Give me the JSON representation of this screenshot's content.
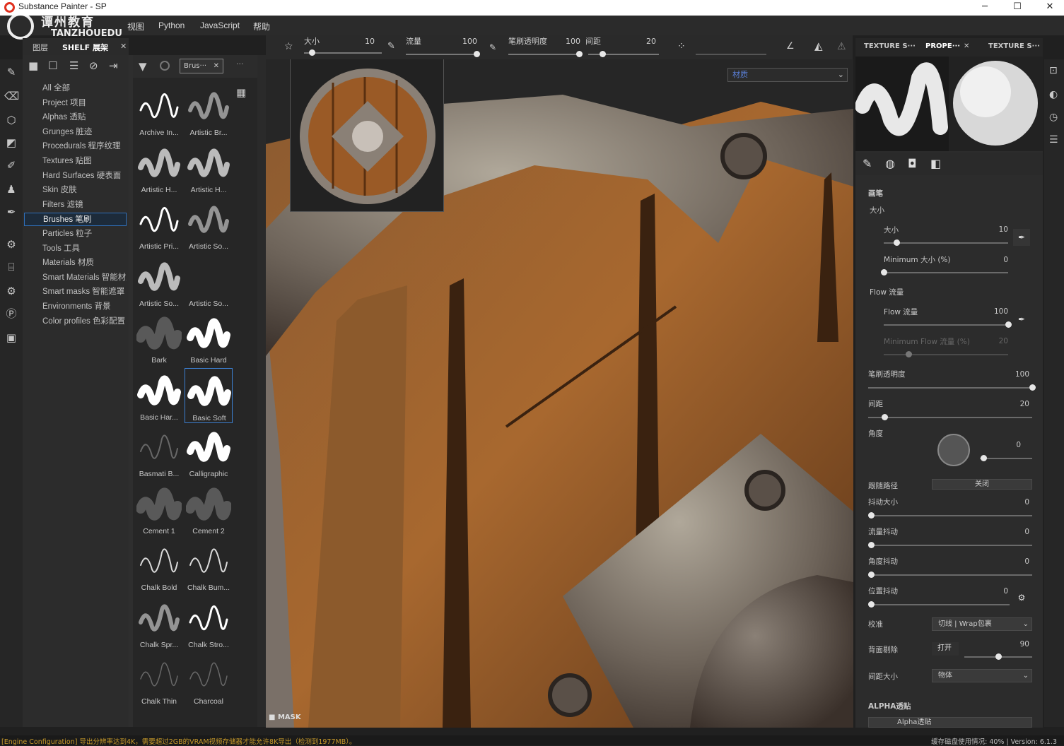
{
  "window": {
    "title": "Substance Painter - SP",
    "min": "─",
    "max": "☐",
    "close": "✕"
  },
  "watermark": {
    "line1": "TANZHOUEDU",
    "line2": "TANZHOUEDU",
    "cn": "谭州教育"
  },
  "menu": [
    "视图",
    "Python",
    "JavaScript",
    "帮助"
  ],
  "shelf_tabs": {
    "layers": "图层",
    "shelf": "SHELF 展架",
    "close": "✕"
  },
  "categories": [
    {
      "label": "All 全部"
    },
    {
      "label": "Project 项目"
    },
    {
      "label": "Alphas 透贴"
    },
    {
      "label": "Grunges 脏迹"
    },
    {
      "label": "Procedurals 程序纹理"
    },
    {
      "label": "Textures 贴图"
    },
    {
      "label": "Hard Surfaces 硬表面"
    },
    {
      "label": "Skin 皮肤"
    },
    {
      "label": "Filters 滤镜"
    },
    {
      "label": "Brushes 笔刷"
    },
    {
      "label": "Particles 粒子"
    },
    {
      "label": "Tools 工具"
    },
    {
      "label": "Materials 材质"
    },
    {
      "label": "Smart Materials 智能材质"
    },
    {
      "label": "Smart masks 智能遮罩"
    },
    {
      "label": "Environments 背景"
    },
    {
      "label": "Color profiles 色彩配置"
    }
  ],
  "brush_filter": {
    "chip": "Brus···",
    "chip_close": "✕",
    "more": "···"
  },
  "brushes": [
    {
      "label": "Archive In...",
      "style": "hard"
    },
    {
      "label": "Artistic Br...",
      "style": "soft"
    },
    {
      "label": "Artistic H...",
      "style": "rough"
    },
    {
      "label": "Artistic H...",
      "style": "rough"
    },
    {
      "label": "Artistic Pri...",
      "style": "hard"
    },
    {
      "label": "Artistic So...",
      "style": "soft"
    },
    {
      "label": "Artistic So...",
      "style": "rough"
    },
    {
      "label": "Artistic So...",
      "style": "none"
    },
    {
      "label": "Bark",
      "style": "blur"
    },
    {
      "label": "Basic Hard",
      "style": "bold"
    },
    {
      "label": "Basic Har...",
      "style": "bold"
    },
    {
      "label": "Basic Soft",
      "style": "bold"
    },
    {
      "label": "Basmati B...",
      "style": "dots"
    },
    {
      "label": "Calligraphic",
      "style": "bold"
    },
    {
      "label": "Cement 1",
      "style": "blur"
    },
    {
      "label": "Cement 2",
      "style": "blur"
    },
    {
      "label": "Chalk Bold",
      "style": "thin"
    },
    {
      "label": "Chalk Bum...",
      "style": "thin"
    },
    {
      "label": "Chalk Spr...",
      "style": "soft"
    },
    {
      "label": "Chalk Stro...",
      "style": "hard"
    },
    {
      "label": "Chalk Thin",
      "style": "faint"
    },
    {
      "label": "Charcoal",
      "style": "faint"
    }
  ],
  "selected_brush": "Basic Soft",
  "selected_category": "Brushes 笔刷",
  "toolbar": {
    "size_label": "大小",
    "size_value": "10",
    "flow_label": "流量",
    "flow_value": "100",
    "opacity_label": "笔刷透明度",
    "opacity_value": "100",
    "spacing_label": "间距",
    "spacing_value": "20",
    "levels": {
      "size": 0.1,
      "flow": 1.0,
      "opacity": 1.0,
      "spacing": 0.2
    }
  },
  "viewport": {
    "material_select": "材质",
    "mask_label": "MASK"
  },
  "right_tabs": {
    "tab1": "TEXTURE S···",
    "tab2": "PROPE···",
    "tab2_close": "✕",
    "tab3": "TEXTURE S···"
  },
  "props": {
    "section_brush": "画笔",
    "size_group": "大小",
    "size_label": "大小",
    "size_value": "10",
    "min_size_label": "Minimum 大小 (%)",
    "min_size_value": "0",
    "flow_group": "Flow 流量",
    "flow_label": "Flow 流量",
    "flow_value": "100",
    "min_flow_label": "Minimum Flow 流量 (%)",
    "min_flow_value": "20",
    "opacity_label": "笔刷透明度",
    "opacity_value": "100",
    "spacing_label": "间距",
    "spacing_value": "20",
    "angle_label": "角度",
    "angle_value": "0",
    "follow_path_label": "跟随路径",
    "follow_path_value": "关闭",
    "size_jitter_label": "抖动大小",
    "size_jitter_value": "0",
    "flow_jitter_label": "流量抖动",
    "flow_jitter_value": "0",
    "angle_jitter_label": "角度抖动",
    "angle_jitter_value": "0",
    "position_jitter_label": "位置抖动",
    "position_jitter_value": "0",
    "alignment_label": "校准",
    "alignment_value": "切线 | Wrap包裹",
    "backface_label": "背面剔除",
    "backface_value": "打开",
    "backface_angle": "90",
    "spacing_size_label": "间距大小",
    "spacing_size_value": "物体",
    "alpha_section": "ALPHA透贴",
    "alpha_value": "Alpha透贴",
    "levels": {
      "size": 0.1,
      "min_size": 0,
      "flow": 1.0,
      "min_flow": 0.2,
      "opacity": 1.0,
      "spacing": 0.1,
      "backface": 0.5
    }
  },
  "status": {
    "left": "[Engine Configuration] 导出分辨率达到4K，需要超过2GB的VRAM视频存储器才能允许8K导出（检测到1977MB）。",
    "right": "缓存磁盘使用情况: 40% | Version: 6.1.3"
  },
  "colors": {
    "accent": "#3c7fd0",
    "warn": "#c89a2a"
  }
}
